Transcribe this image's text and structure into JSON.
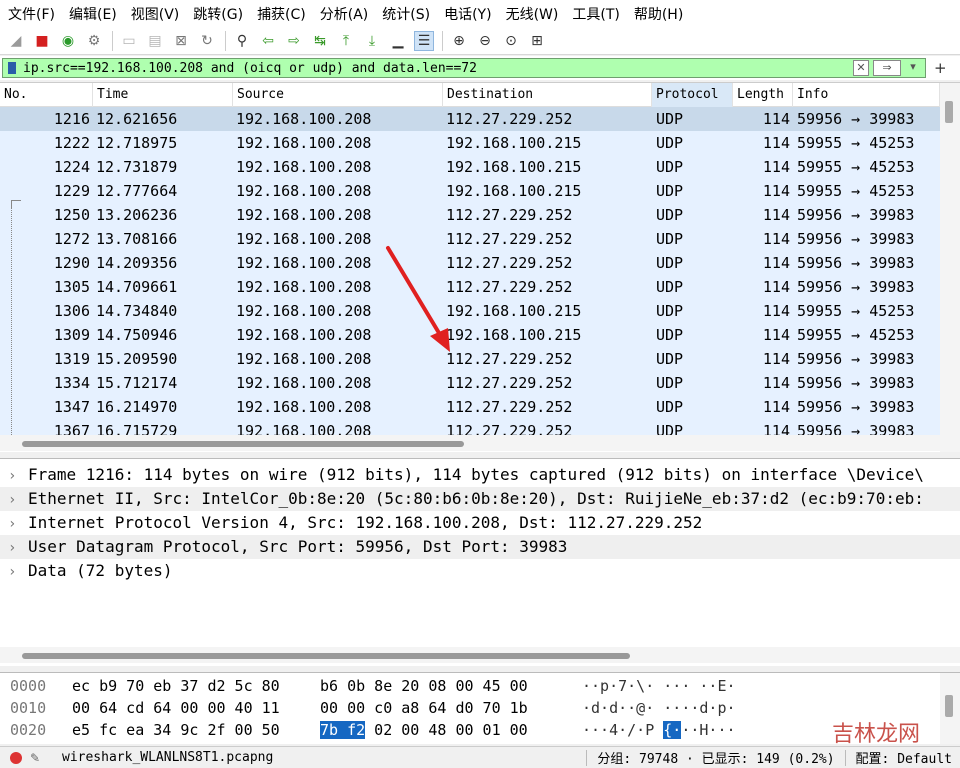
{
  "menu": [
    "文件(F)",
    "编辑(E)",
    "视图(V)",
    "跳转(G)",
    "捕获(C)",
    "分析(A)",
    "统计(S)",
    "电话(Y)",
    "无线(W)",
    "工具(T)",
    "帮助(H)"
  ],
  "toolbar": {
    "icons": [
      "shark-fin-icon",
      "stop-capture-icon",
      "restart-capture-icon",
      "capture-options-icon",
      "separator",
      "open-file-icon",
      "save-file-icon",
      "close-file-icon",
      "reload-file-icon",
      "separator",
      "find-packet-icon",
      "go-back-icon",
      "go-forward-icon",
      "go-to-packet-icon",
      "go-first-icon",
      "go-last-icon",
      "auto-scroll-icon",
      "colorize-icon",
      "separator",
      "zoom-in-icon",
      "zoom-out-icon",
      "zoom-normal-icon",
      "resize-columns-icon"
    ]
  },
  "filter": {
    "value": "ip.src==192.168.100.208 and (oicq or udp) and data.len==72",
    "plus": "+"
  },
  "packet_list": {
    "columns": [
      "No.",
      "Time",
      "Source",
      "Destination",
      "Protocol",
      "Length",
      "Info"
    ],
    "rows": [
      {
        "no": "1216",
        "time": "12.621656",
        "src": "192.168.100.208",
        "dst": "112.27.229.252",
        "proto": "UDP",
        "len": "114",
        "info": "59956 → 39983"
      },
      {
        "no": "1222",
        "time": "12.718975",
        "src": "192.168.100.208",
        "dst": "192.168.100.215",
        "proto": "UDP",
        "len": "114",
        "info": "59955 → 45253"
      },
      {
        "no": "1224",
        "time": "12.731879",
        "src": "192.168.100.208",
        "dst": "192.168.100.215",
        "proto": "UDP",
        "len": "114",
        "info": "59955 → 45253"
      },
      {
        "no": "1229",
        "time": "12.777664",
        "src": "192.168.100.208",
        "dst": "192.168.100.215",
        "proto": "UDP",
        "len": "114",
        "info": "59955 → 45253"
      },
      {
        "no": "1250",
        "time": "13.206236",
        "src": "192.168.100.208",
        "dst": "112.27.229.252",
        "proto": "UDP",
        "len": "114",
        "info": "59956 → 39983"
      },
      {
        "no": "1272",
        "time": "13.708166",
        "src": "192.168.100.208",
        "dst": "112.27.229.252",
        "proto": "UDP",
        "len": "114",
        "info": "59956 → 39983"
      },
      {
        "no": "1290",
        "time": "14.209356",
        "src": "192.168.100.208",
        "dst": "112.27.229.252",
        "proto": "UDP",
        "len": "114",
        "info": "59956 → 39983"
      },
      {
        "no": "1305",
        "time": "14.709661",
        "src": "192.168.100.208",
        "dst": "112.27.229.252",
        "proto": "UDP",
        "len": "114",
        "info": "59956 → 39983"
      },
      {
        "no": "1306",
        "time": "14.734840",
        "src": "192.168.100.208",
        "dst": "192.168.100.215",
        "proto": "UDP",
        "len": "114",
        "info": "59955 → 45253"
      },
      {
        "no": "1309",
        "time": "14.750946",
        "src": "192.168.100.208",
        "dst": "192.168.100.215",
        "proto": "UDP",
        "len": "114",
        "info": "59955 → 45253"
      },
      {
        "no": "1319",
        "time": "15.209590",
        "src": "192.168.100.208",
        "dst": "112.27.229.252",
        "proto": "UDP",
        "len": "114",
        "info": "59956 → 39983"
      },
      {
        "no": "1334",
        "time": "15.712174",
        "src": "192.168.100.208",
        "dst": "112.27.229.252",
        "proto": "UDP",
        "len": "114",
        "info": "59956 → 39983"
      },
      {
        "no": "1347",
        "time": "16.214970",
        "src": "192.168.100.208",
        "dst": "112.27.229.252",
        "proto": "UDP",
        "len": "114",
        "info": "59956 → 39983"
      },
      {
        "no": "1367",
        "time": "16.715729",
        "src": "192.168.100.208",
        "dst": "112.27.229.252",
        "proto": "UDP",
        "len": "114",
        "info": "59956 → 39983"
      }
    ]
  },
  "details": [
    "Frame 1216: 114 bytes on wire (912 bits), 114 bytes captured (912 bits) on interface \\Device\\",
    "Ethernet II, Src: IntelCor_0b:8e:20 (5c:80:b6:0b:8e:20), Dst: RuijieNe_eb:37:d2 (ec:b9:70:eb:",
    "Internet Protocol Version 4, Src: 192.168.100.208, Dst: 112.27.229.252",
    "User Datagram Protocol, Src Port: 59956, Dst Port: 39983",
    "Data (72 bytes)"
  ],
  "bytes": [
    {
      "off": "0000",
      "hex1": "ec b9 70 eb 37 d2 5c 80",
      "hex2": "b6 0b 8e 20 08 00 45 00",
      "ascii": "··p·7·\\·  ···  ··E·"
    },
    {
      "off": "0010",
      "hex1": "00 64 cd 64 00 00 40 11",
      "hex2": "00 00 c0 a8 64 d0 70 1b",
      "ascii": "·d·d··@·  ····d·p·"
    },
    {
      "off": "0020",
      "hex1": "e5 fc ea 34 9c 2f 00 50",
      "hex2_hl": "7b f2",
      "hex2_rest": " 02 00 48 00 01 00",
      "ascii_pre": "···4·/·P ",
      "ascii_hl": "{·",
      "ascii_post": "··H···"
    }
  ],
  "status": {
    "file": "wireshark_WLANLNS8T1.pcapng",
    "stats": "分组: 79748 · 已显示: 149 (0.2%)",
    "profile": "配置: Default"
  },
  "watermark": "吉林龙网",
  "colors": {
    "row_bg": "#e6f1ff",
    "row_selected": "#c8d9ea",
    "filter_ok": "#afffaf",
    "arrow": "#e02020"
  }
}
